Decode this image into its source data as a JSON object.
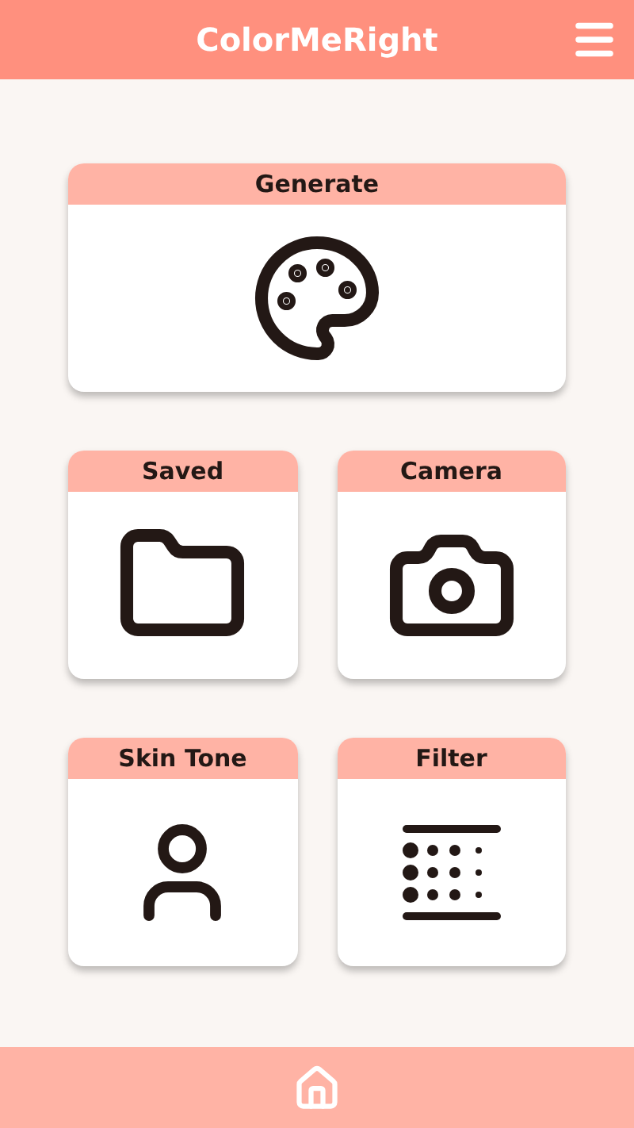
{
  "header": {
    "title": "ColorMeRight"
  },
  "rows": [
    [
      {
        "label": "Generate",
        "kind": "palette"
      }
    ],
    [
      {
        "label": "Saved",
        "kind": "folder"
      },
      {
        "label": "Camera",
        "kind": "camera"
      }
    ],
    [
      {
        "label": "Skin Tone",
        "kind": "person"
      },
      {
        "label": "Filter",
        "kind": "filter"
      }
    ]
  ],
  "footer": {
    "items": [
      {
        "kind": "home"
      }
    ]
  }
}
